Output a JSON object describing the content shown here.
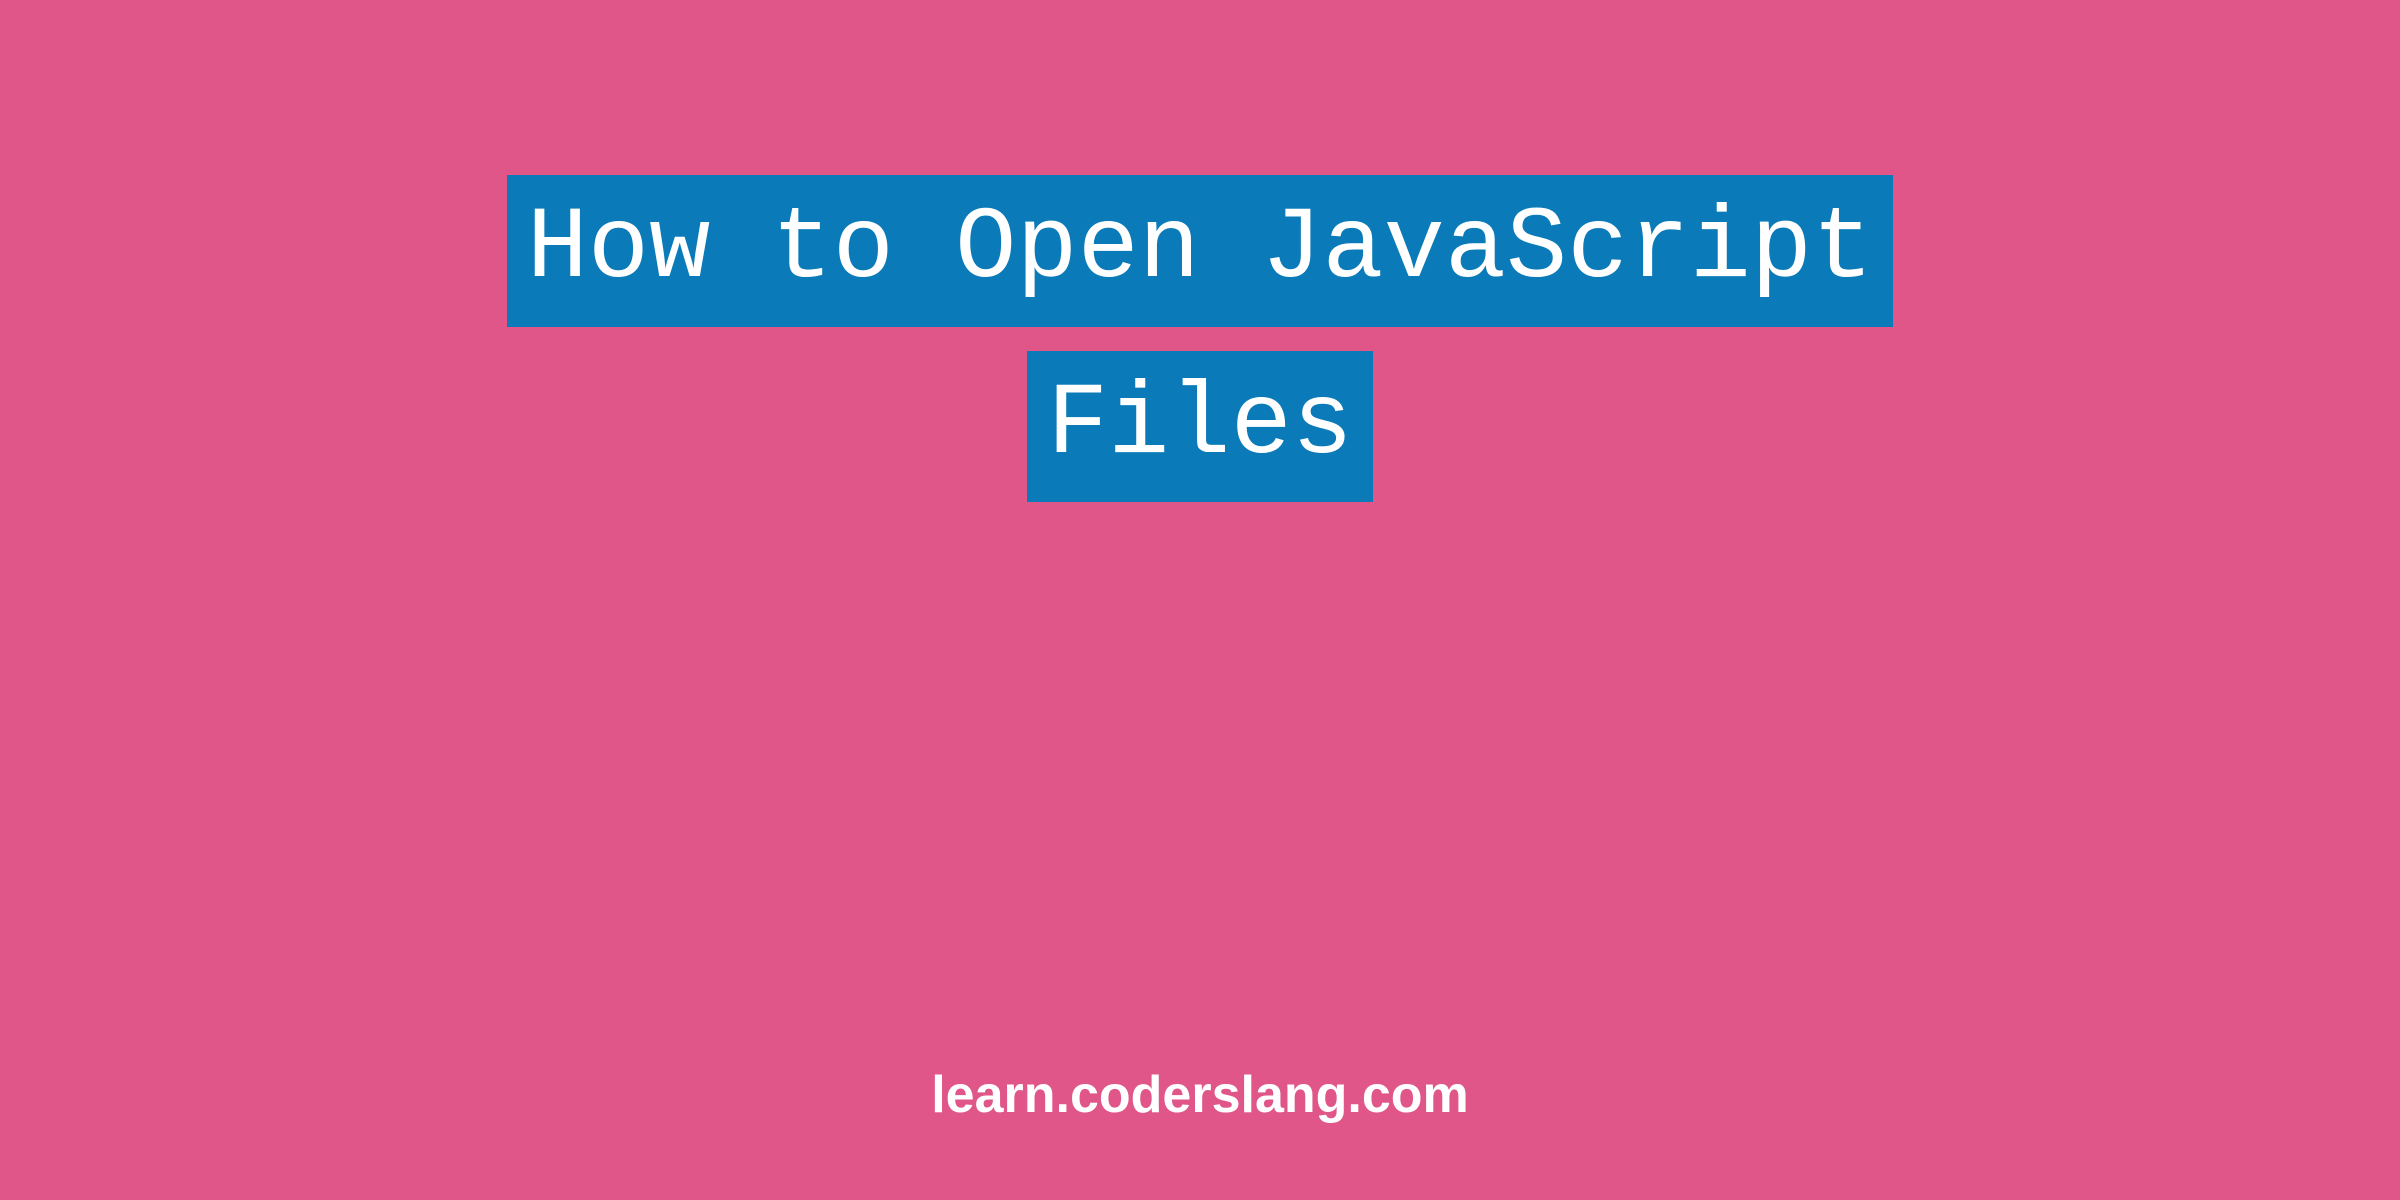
{
  "title": {
    "line1": "How to Open JavaScript",
    "line2": "Files"
  },
  "footer": {
    "url": "learn.coderslang.com"
  }
}
